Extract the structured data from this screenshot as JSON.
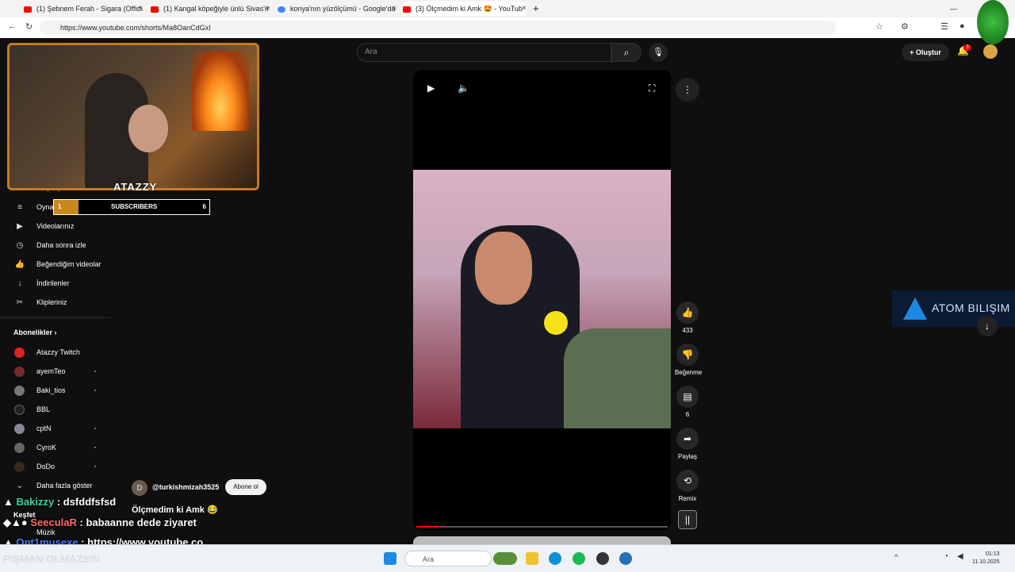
{
  "browser": {
    "tabs": [
      {
        "label": "(1) Şebnem Ferah - Sigara (Officia",
        "color": "#ff0000"
      },
      {
        "label": "(1) Kangal köpeğiyle ünlü Sivas'ın",
        "color": "#ff0000"
      },
      {
        "label": "konya'nın yüzölçümü - Google'da",
        "color": "#4285f4"
      },
      {
        "label": "(3) Ölçmedim ki Amk 🤩 - YouTub",
        "color": "#ff0000"
      }
    ],
    "new_tab": "+",
    "close_glyph": "×",
    "url": "https://www.youtube.com/shorts/Ma8OanCdGxI"
  },
  "youtube": {
    "search_placeholder": "Ara",
    "create_label": "Oluştur",
    "notification_count": "3",
    "sidebar_items": [
      {
        "label": "Oynatma listeleri",
        "icon": "playlist-icon"
      },
      {
        "label": "Videolarınız",
        "icon": "video-icon"
      },
      {
        "label": "Daha sonra izle",
        "icon": "clock-icon"
      },
      {
        "label": "Beğendiğim videolar",
        "icon": "like-icon"
      },
      {
        "label": "İndirilenler",
        "icon": "download-icon"
      },
      {
        "label": "Klipleriniz",
        "icon": "scissors-icon"
      }
    ],
    "partial_item": "Geçmiş",
    "subscriptions_header": "Abonelikler",
    "subscriptions": [
      {
        "name": "Atazzy Twitch",
        "live": false
      },
      {
        "name": "ayemTeo",
        "live": true
      },
      {
        "name": "Baki_tios",
        "live": true
      },
      {
        "name": "BBL",
        "live": false
      },
      {
        "name": "cptN",
        "live": true
      },
      {
        "name": "CyroK",
        "live": true
      },
      {
        "name": "DoDo",
        "live": true
      }
    ],
    "show_more": "Daha fazla göster",
    "explore_header": "Keşfet",
    "explore_music": "Müzik"
  },
  "overlay": {
    "brand": "ATAZZY",
    "sub_goal": {
      "current": "1",
      "label": "SUBSCRIBERS",
      "target": "6",
      "progress": 0.16
    }
  },
  "short": {
    "channel_initial": "D",
    "channel": "@turkishmizah3525",
    "subscribe_label": "Abone ol",
    "title": "Ölçmedim ki Amk 😂",
    "likes": "433",
    "dislike_label": "Beğenme",
    "comments": "6",
    "share_label": "Paylaş",
    "remix_label": "Remix",
    "progress": 0.09
  },
  "chat": [
    {
      "user": "Bakizzy",
      "user_color": "#3fd4a0",
      "message": ": dsfddfsfsd"
    },
    {
      "user": "SeeculaR",
      "user_color": "#ff6b6b",
      "message": ": babaanne dede ziyaret"
    },
    {
      "user": "Opt1musexe",
      "user_color": "#4a7bff",
      "message": ": https://www.youtube.co"
    }
  ],
  "ad": {
    "text": "ATOM BILIŞIM"
  },
  "bottom_caption": "PIŞMAN OLMAZSIN",
  "taskbar": {
    "search_placeholder": "Ara",
    "time": "01:13",
    "date": "11.10.2025"
  }
}
